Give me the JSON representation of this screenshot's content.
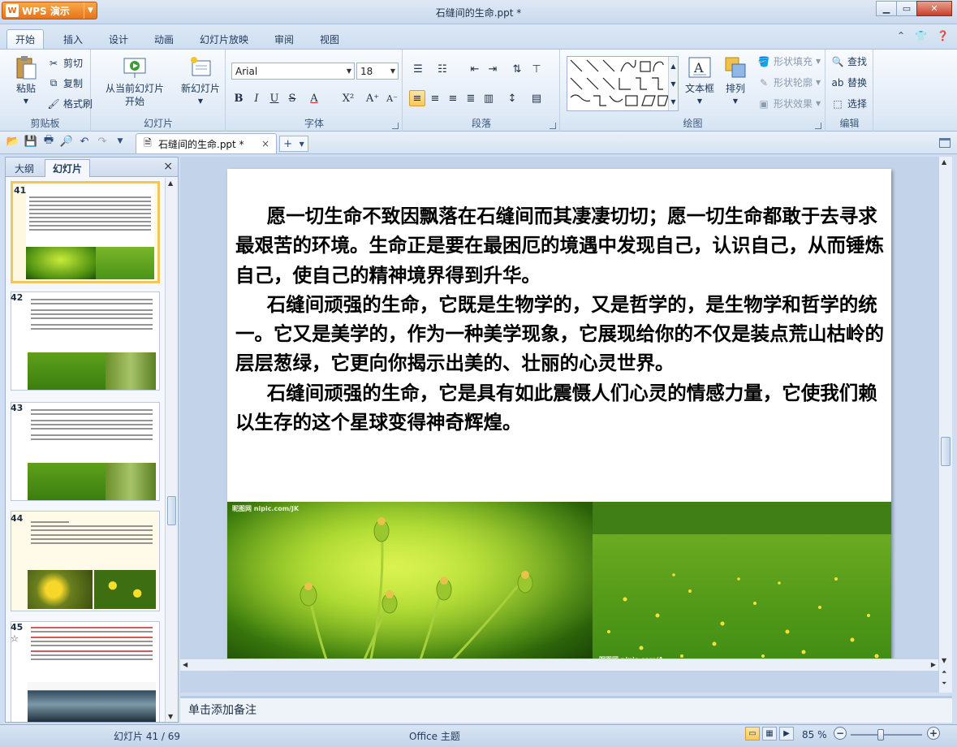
{
  "app": {
    "name": "WPS 演示",
    "logo": "W",
    "title": "石缝间的生命.ppt *"
  },
  "window_controls": {
    "minimize": "▁",
    "maximize": "▭",
    "close": "✕"
  },
  "tabs": [
    "开始",
    "插入",
    "设计",
    "动画",
    "幻灯片放映",
    "审阅",
    "视图"
  ],
  "ribbon": {
    "clipboard": {
      "label": "剪贴板",
      "paste": "粘贴",
      "cut": "剪切",
      "copy": "复制",
      "format_painter": "格式刷"
    },
    "slides": {
      "label": "幻灯片",
      "from_current_1": "从当前幻灯片",
      "from_current_2": "开始",
      "new_slide": "新幻灯片"
    },
    "font": {
      "label": "字体",
      "family": "Arial",
      "size": "18",
      "bold": "B",
      "italic": "I",
      "underline": "U",
      "strike": "S",
      "color": "A",
      "superscript": "X²",
      "grow": "A⁺",
      "shrink": "A⁻"
    },
    "paragraph": {
      "label": "段落"
    },
    "drawing": {
      "label": "绘图",
      "textbox": "文本框",
      "arrange": "排列",
      "shape_fill": "形状填充",
      "shape_outline": "形状轮廓",
      "shape_effect": "形状效果"
    },
    "editing": {
      "label": "编辑",
      "find": "查找",
      "replace": "替换",
      "select": "选择"
    }
  },
  "doc_tab": {
    "name": "石缝间的生命.ppt *",
    "close": "×",
    "new": "+"
  },
  "left_panel": {
    "tabs": [
      "大纲",
      "幻灯片"
    ],
    "close": "×",
    "slides": [
      {
        "num": "41",
        "selected": true
      },
      {
        "num": "42",
        "selected": false
      },
      {
        "num": "43",
        "selected": false
      },
      {
        "num": "44",
        "selected": false
      },
      {
        "num": "45",
        "selected": false,
        "sub": "☆"
      }
    ]
  },
  "slide": {
    "paragraphs": [
      "愿一切生命不致因飘落在石缝间而其凄凄切切；愿一切生命都敢于去寻求最艰苦的环境。生命正是要在最困厄的境遇中发现自己，认识自己，从而锤炼自己，使自己的精神境界得到升华。",
      "石缝间顽强的生命，它既是生物学的，又是哲学的，是生物学和哲学的统一。它又是美学的，作为一种美学现象，它展现给你的不仅是装点荒山枯岭的层层葱绿，它更向你揭示出美的、壮丽的心灵世界。",
      " 石缝间顽强的生命，它是具有如此震慑人们心灵的情感力量，它使我们赖以生存的这个星球变得神奇辉煌。"
    ],
    "watermark1": "昵图网 nipic.com/JK",
    "watermark2": "昵图网 nipic.com/A"
  },
  "notes_placeholder": "单击添加备注",
  "status": {
    "slide_counter": "幻灯片 41 / 69",
    "theme": "Office 主题",
    "zoom": "85 %"
  },
  "colors": {
    "accent": "#e8731a",
    "selection": "#f3c55d",
    "ribbon_bg": "#dfeaf6"
  }
}
